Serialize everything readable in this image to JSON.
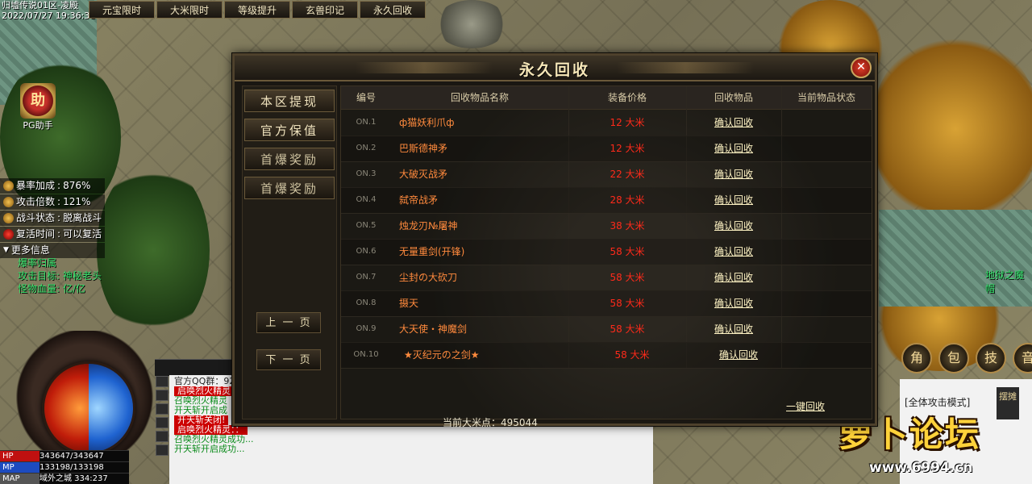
{
  "top": {
    "server": "归墟传说01区-凌殿",
    "datetime": "2022/07/27 19:36:31",
    "tabs": [
      "元宝限时",
      "大米限时",
      "等级提升",
      "玄兽印记",
      "永久回收"
    ]
  },
  "helper": {
    "badge": "助",
    "label": "PG助手"
  },
  "stats": [
    {
      "label": "暴率加成",
      "value": "876%"
    },
    {
      "label": "攻击倍数",
      "value": "121%"
    },
    {
      "label": "战斗状态",
      "value": "脱离战斗"
    },
    {
      "label": "复活时间",
      "value": "可以复活"
    },
    {
      "label": "更多信息",
      "value": ""
    }
  ],
  "extra_lines": [
    "爆率归属",
    "攻击目标: 神秘老头",
    "怪物血量: 亿/亿"
  ],
  "hud": {
    "hp": {
      "label": "HP",
      "value": "343647/343647"
    },
    "mp": {
      "label": "MP",
      "value": "133198/133198"
    },
    "map": {
      "label": "MAP",
      "value": "域外之城 334:237"
    }
  },
  "chat": {
    "lines": [
      {
        "text": "官方QQ群：92",
        "style": "plain"
      },
      {
        "text": "启唤烈火精灵",
        "style": "red"
      },
      {
        "text": "召唤烈火精灵",
        "style": "green"
      },
      {
        "text": "开天斩开启成",
        "style": "green"
      },
      {
        "text": "开天斩关闭!",
        "style": "red"
      },
      {
        "text": "启唤烈火精灵：：",
        "style": "red"
      },
      {
        "text": "召唤烈火精灵成功...",
        "style": "green"
      },
      {
        "text": "开天斩开启成功...",
        "style": "green"
      }
    ]
  },
  "right": {
    "buttons": [
      "角",
      "包",
      "技",
      "音"
    ],
    "attack_mode": "[全体攻击模式]",
    "stall": "摆摊",
    "npc": "地狱之魔帽"
  },
  "logo": {
    "text": "萝卜论坛",
    "url": "www.6994.cn"
  },
  "dialog": {
    "title": "永久回收",
    "close": "✕",
    "side_buttons": [
      "本区提现",
      "官方保值",
      "首爆奖励",
      "首爆奖励"
    ],
    "prev_page": "上 一 页",
    "next_page": "下 一 页",
    "headers": [
      "编号",
      "回收物品名称",
      "装备价格",
      "回收物品",
      "当前物品状态"
    ],
    "rows": [
      {
        "no": "ON.1",
        "name": "ф猫妖利爪ф",
        "price": "12 大米",
        "action": "确认回收"
      },
      {
        "no": "ON.2",
        "name": "巴斯德神矛",
        "price": "12 大米",
        "action": "确认回收"
      },
      {
        "no": "ON.3",
        "name": "大破灭战矛",
        "price": "22 大米",
        "action": "确认回收"
      },
      {
        "no": "ON.4",
        "name": "弑帝战矛",
        "price": "28 大米",
        "action": "确认回收"
      },
      {
        "no": "ON.5",
        "name": "烛龙刃№屠神",
        "price": "38 大米",
        "action": "确认回收"
      },
      {
        "no": "ON.6",
        "name": "无量重剑(开锋)",
        "price": "58 大米",
        "action": "确认回收"
      },
      {
        "no": "ON.7",
        "name": "尘封の大砍刀",
        "price": "58 大米",
        "action": "确认回收"
      },
      {
        "no": "ON.8",
        "name": "摄天",
        "price": "58 大米",
        "action": "确认回收"
      },
      {
        "no": "ON.9",
        "name": "大天使・神魔剑",
        "price": "58 大米",
        "action": "确认回收"
      },
      {
        "no": "ON.10",
        "name": "★灭纪元の之剑★",
        "price": "58 大米",
        "action": "确认回收"
      }
    ],
    "one_key": "一键回收",
    "points_label": "当前大米点：",
    "points_value": "495044"
  }
}
